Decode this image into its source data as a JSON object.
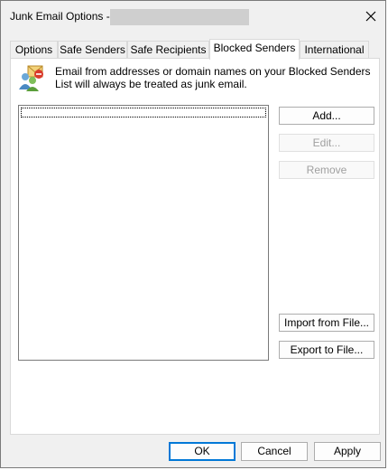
{
  "window": {
    "title": "Junk Email Options -",
    "close_icon": "close-icon"
  },
  "tabs": [
    {
      "label": "Options",
      "active": false
    },
    {
      "label": "Safe Senders",
      "active": false
    },
    {
      "label": "Safe Recipients",
      "active": false
    },
    {
      "label": "Blocked Senders",
      "active": true
    },
    {
      "label": "International",
      "active": false
    }
  ],
  "blocked_senders": {
    "description": "Email from addresses or domain names on your Blocked Senders List will always be treated as junk email.",
    "icon": "blocked-users-icon",
    "list_items": [],
    "buttons": {
      "add": "Add...",
      "edit": "Edit...",
      "remove": "Remove",
      "import": "Import from File...",
      "export": "Export to File..."
    }
  },
  "footer": {
    "ok": "OK",
    "cancel": "Cancel",
    "apply": "Apply"
  },
  "colors": {
    "default_button_border": "#0078d7",
    "disabled_text": "#a0a0a0"
  }
}
